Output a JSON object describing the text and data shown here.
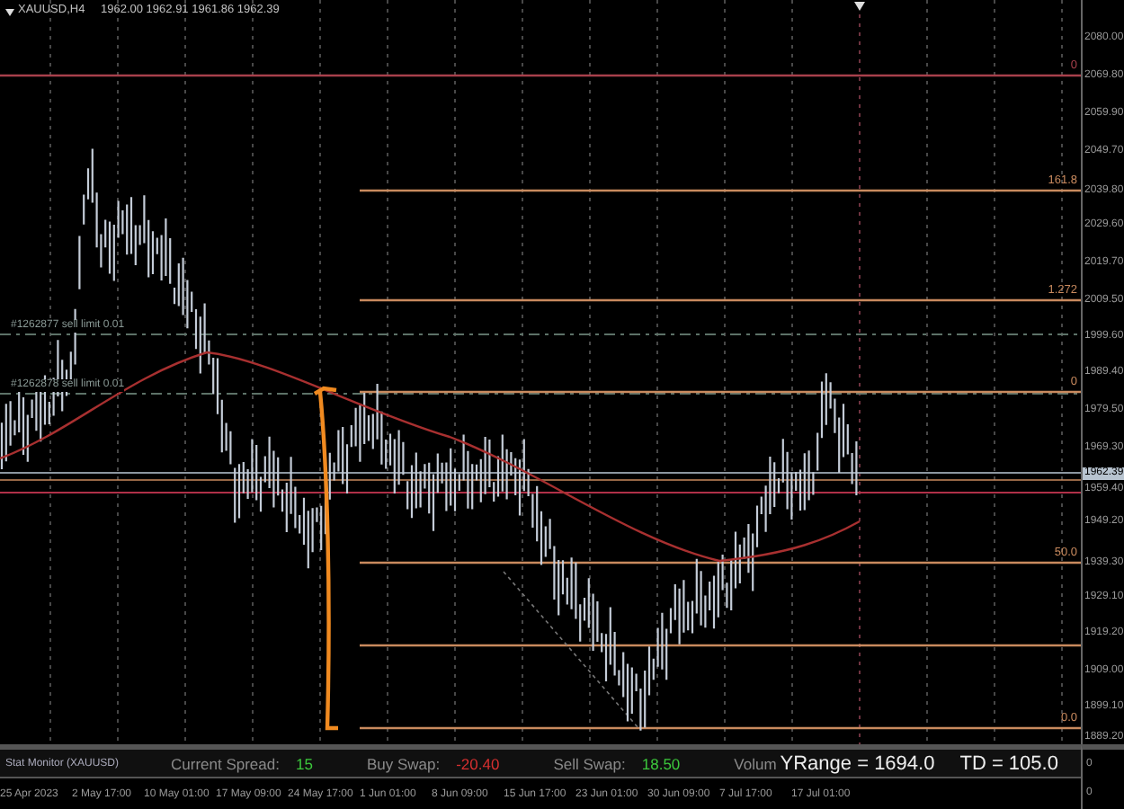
{
  "chart_header": {
    "symbol": "XAUUSD,H4",
    "prices": "1962.00 1962.91 1961.86 1962.39"
  },
  "order_labels": [
    {
      "text": "#1262877 sell limit 0.01"
    },
    {
      "text": "#1262878 sell limit 0.01"
    }
  ],
  "fib_levels": [
    {
      "label": "0",
      "color": "#a8404c"
    },
    {
      "label": "161.8",
      "color": "#c98a5e"
    },
    {
      "label": "1.272",
      "color": "#c98a5e"
    },
    {
      "label": "0",
      "color": "#c98a5e"
    },
    {
      "label": "50.0",
      "color": "#c98a5e"
    },
    {
      "label": "0.0",
      "color": "#c98a5e"
    }
  ],
  "price_axis": [
    {
      "label": "2080.00",
      "kind": "tick"
    },
    {
      "label": "2069.80",
      "kind": "tick"
    },
    {
      "label": "2059.90",
      "kind": "tick"
    },
    {
      "label": "2049.70",
      "kind": "tick"
    },
    {
      "label": "2039.80",
      "kind": "tick"
    },
    {
      "label": "2029.60",
      "kind": "tick"
    },
    {
      "label": "2019.70",
      "kind": "tick"
    },
    {
      "label": "2009.50",
      "kind": "tick"
    },
    {
      "label": "1999.60",
      "kind": "tick"
    },
    {
      "label": "1989.40",
      "kind": "tick"
    },
    {
      "label": "1979.50",
      "kind": "tick"
    },
    {
      "label": "1969.30",
      "kind": "tick"
    },
    {
      "label": "1962.39",
      "kind": "current"
    },
    {
      "label": "1959.40",
      "kind": "tick"
    },
    {
      "label": "1949.20",
      "kind": "tick"
    },
    {
      "label": "1939.30",
      "kind": "tick"
    },
    {
      "label": "1929.10",
      "kind": "tick"
    },
    {
      "label": "1919.20",
      "kind": "tick"
    },
    {
      "label": "1909.00",
      "kind": "tick"
    },
    {
      "label": "1899.10",
      "kind": "tick"
    },
    {
      "label": "1889.20",
      "kind": "tick"
    }
  ],
  "stat_panel": {
    "title": "Stat Monitor (XAUUSD)",
    "stats": [
      {
        "label": "Current Spread:",
        "value": "15",
        "color": "#3cc83c"
      },
      {
        "label": "Buy Swap:",
        "value": "-20.40",
        "color": "#d83030"
      },
      {
        "label": "Sell Swap:",
        "value": "18.50",
        "color": "#3cc83c"
      }
    ],
    "volume_label": "Volum",
    "yrange": "YRange = 1694.0",
    "td": "TD = 105.0",
    "indicator_values": [
      "0",
      "0"
    ]
  },
  "time_axis": [
    "25 Apr 2023",
    "2 May 17:00",
    "10 May 01:00",
    "17 May 09:00",
    "24 May 17:00",
    "1 Jun 01:00",
    "8 Jun 09:00",
    "15 Jun 17:00",
    "23 Jun 01:00",
    "30 Jun 09:00",
    "7 Jul 17:00",
    "17 Jul 01:00"
  ]
}
